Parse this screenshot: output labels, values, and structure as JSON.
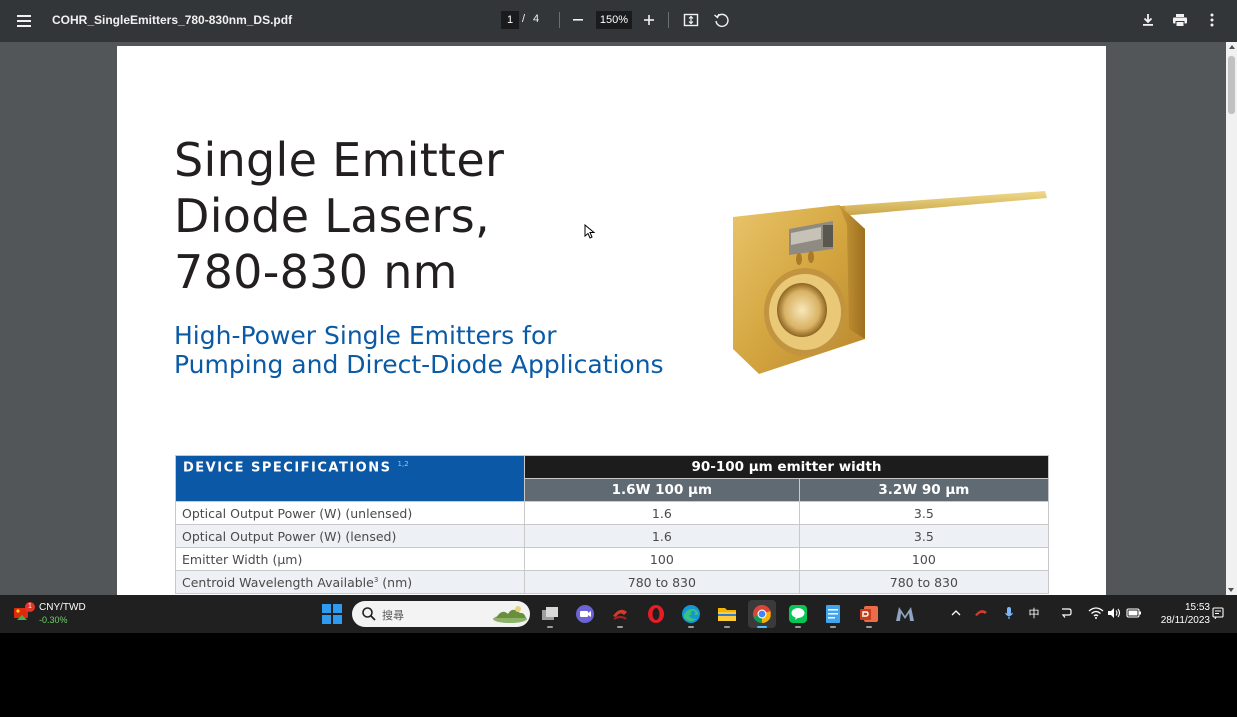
{
  "viewer": {
    "file_name": "COHR_SingleEmitters_780-830nm_DS.pdf",
    "current_page": "1",
    "page_separator": "/",
    "total_pages": "4",
    "zoom": "150%"
  },
  "page": {
    "title_lines": [
      "Single Emitter",
      "Diode Lasers,",
      "780-830 nm"
    ],
    "subtitle_lines": [
      "High-Power Single Emitters for",
      "Pumping and Direct-Diode Applications"
    ],
    "table": {
      "section_label": "DEVICE SPECIFICATIONS",
      "section_superscript": "1,2",
      "group_header": "90-100 µm emitter width",
      "columns": [
        "1.6W 100 µm",
        "3.2W 90 µm"
      ],
      "rows": [
        {
          "label": "Optical Output Power (W) (unlensed)",
          "superscript": "",
          "label_suffix": "",
          "values": [
            "1.6",
            "3.5"
          ]
        },
        {
          "label": "Optical Output Power (W) (lensed)",
          "superscript": "",
          "label_suffix": "",
          "values": [
            "1.6",
            "3.5"
          ]
        },
        {
          "label": "Emitter Width (µm)",
          "superscript": "",
          "label_suffix": "",
          "values": [
            "100",
            "100"
          ]
        },
        {
          "label": "Centroid Wavelength Available",
          "superscript": "3",
          "label_suffix": " (nm)",
          "values": [
            "780 to 830",
            "780 to 830"
          ]
        }
      ]
    }
  },
  "taskbar": {
    "widget": {
      "name": "CNY/TWD",
      "change": "-0.30%",
      "badge": "1"
    },
    "search_placeholder": "搜尋",
    "apps": [
      "task-view",
      "teams-chat",
      "anydesk",
      "opera",
      "edge",
      "file-explorer",
      "chrome",
      "line",
      "notepad",
      "powerpoint",
      "m-app"
    ],
    "ime_label": "中",
    "clock": {
      "time": "15:53",
      "date": "28/11/2023"
    }
  },
  "colors": {
    "toolbar_bg": "#323639",
    "viewer_bg": "#525659",
    "accent_blue": "#0b58a7",
    "title_text": "#231f20",
    "taskbar_bg": "#202020"
  }
}
